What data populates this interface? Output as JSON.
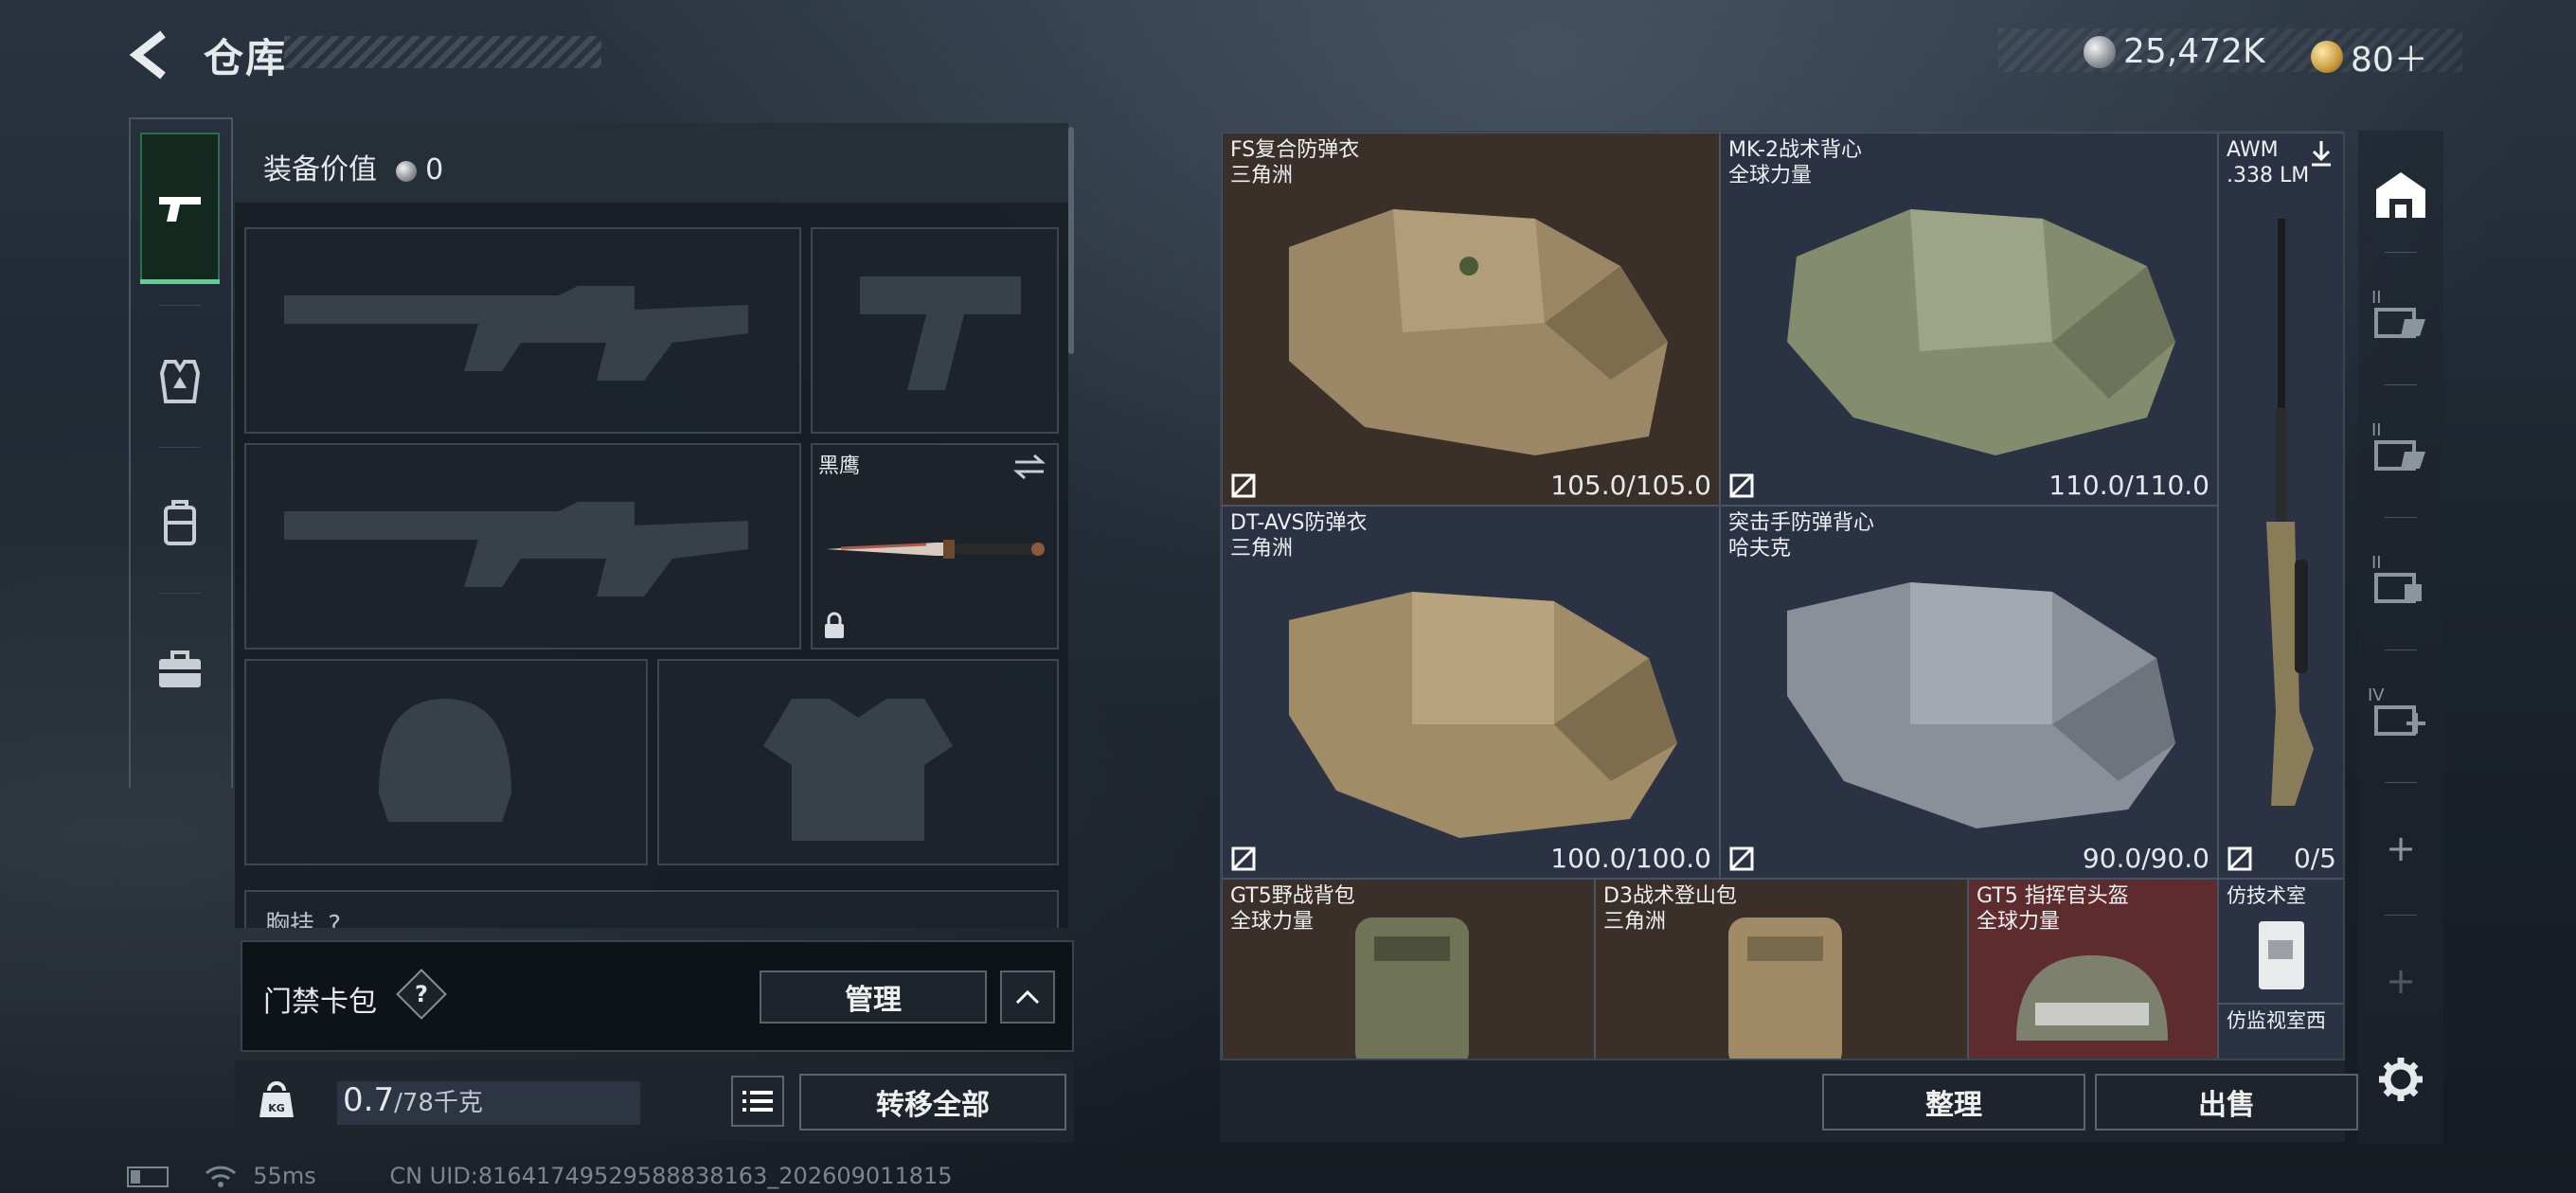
{
  "header": {
    "title": "仓库",
    "currency": [
      {
        "icon": "silver-coin-icon",
        "value": "25,472K"
      },
      {
        "icon": "gold-coin-icon",
        "value": "80＋"
      }
    ]
  },
  "equipment": {
    "value_label": "装备价值",
    "value": "0",
    "melee_name": "黑鹰",
    "next_section_label": "胸挂",
    "next_section_hint": "?"
  },
  "keycard": {
    "label": "门禁卡包",
    "help": "?",
    "manage_label": "管理"
  },
  "weight": {
    "current": "0.7",
    "capacity": "/78千克",
    "icon_text": "KG",
    "transfer_all_label": "转移全部"
  },
  "status": {
    "ping": "55ms",
    "uid": "CN UID:816417495295888381​63_202609011815"
  },
  "inventory": {
    "items": [
      {
        "name": "FS复合防弹衣",
        "source": "三角洲",
        "durability": "105.0/105.0"
      },
      {
        "name": "MK-2战术背心",
        "source": "全球力量",
        "durability": "110.0/110.0"
      },
      {
        "name": "AWM",
        "source": ".338 LM",
        "durability": "0/5"
      },
      {
        "name": "DT-AVS防弹衣",
        "source": "三角洲",
        "durability": "100.0/100.0"
      },
      {
        "name": "突击手防弹背心",
        "source": "哈夫克",
        "durability": "90.0/90.0"
      },
      {
        "name": "GT5野战背包",
        "source": "全球力量"
      },
      {
        "name": "D3战术登山包",
        "source": "三角洲"
      },
      {
        "name": "GT5 指挥官头盔",
        "source": "全球力量"
      },
      {
        "name": "仿技术室",
        "source": ""
      },
      {
        "name": "仿监视室西",
        "source": ""
      }
    ],
    "sort_label": "整理",
    "sell_label": "出售"
  },
  "right_rail": {
    "tier_labels": [
      "II",
      "II",
      "II",
      "IV"
    ],
    "add": "+"
  }
}
